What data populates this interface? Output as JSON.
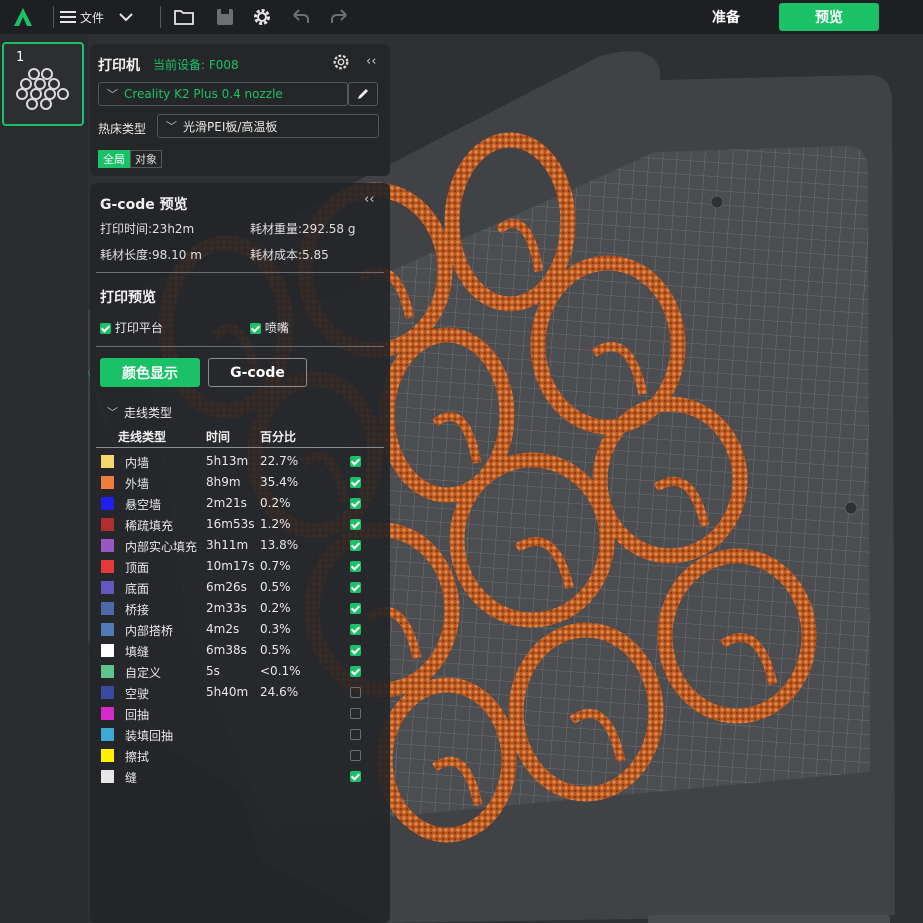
{
  "topbar": {
    "file_label": "文件",
    "prepare_label": "准备",
    "preview_label": "预览"
  },
  "plates": [
    {
      "number": "1"
    }
  ],
  "printer": {
    "title": "打印机",
    "current_device": "当前设备: F008",
    "printer_name": "Creality K2 Plus 0.4 nozzle",
    "bed_label": "热床类型",
    "bed_value": "光滑PEI板/高温板",
    "tab_global": "全局",
    "tab_object": "对象"
  },
  "gcode": {
    "title": "G-code 预览",
    "print_time": "打印时间:23h2m",
    "filament_weight": "耗材重量:292.58 g",
    "filament_length": "耗材长度:98.10 m",
    "filament_cost": "耗材成本:5.85",
    "preview_title": "打印预览",
    "show_plate_label": "打印平台",
    "show_nozzle_label": "喷嘴",
    "color_mode_label": "颜色显示",
    "gcode_mode_label": "G-code",
    "view_type": "走线类型",
    "columns": [
      "走线类型",
      "时间",
      "百分比"
    ],
    "legend": [
      {
        "name": "内墙",
        "time": "5h13m",
        "pct": "22.7%",
        "color": "#f5d76e",
        "checked": true
      },
      {
        "name": "外墙",
        "time": "8h9m",
        "pct": "35.4%",
        "color": "#f07e3c",
        "checked": true
      },
      {
        "name": "悬空墙",
        "time": "2m21s",
        "pct": "0.2%",
        "color": "#1f1ff0",
        "checked": true
      },
      {
        "name": "稀疏填充",
        "time": "16m53s",
        "pct": "1.2%",
        "color": "#b22e2e",
        "checked": true
      },
      {
        "name": "内部实心填充",
        "time": "3h11m",
        "pct": "13.8%",
        "color": "#9957c4",
        "checked": true
      },
      {
        "name": "顶面",
        "time": "10m17s",
        "pct": "0.7%",
        "color": "#e53a3a",
        "checked": true
      },
      {
        "name": "底面",
        "time": "6m26s",
        "pct": "0.5%",
        "color": "#6656c0",
        "checked": true
      },
      {
        "name": "桥接",
        "time": "2m33s",
        "pct": "0.2%",
        "color": "#4d6aa8",
        "checked": true
      },
      {
        "name": "内部搭桥",
        "time": "4m2s",
        "pct": "0.3%",
        "color": "#4f7ab5",
        "checked": true
      },
      {
        "name": "填缝",
        "time": "6m38s",
        "pct": "0.5%",
        "color": "#ffffff",
        "checked": true
      },
      {
        "name": "自定义",
        "time": "5s",
        "pct": "<0.1%",
        "color": "#5ec48f",
        "checked": true
      },
      {
        "name": "空驶",
        "time": "5h40m",
        "pct": "24.6%",
        "color": "#3a4aa0",
        "checked": false
      },
      {
        "name": "回抽",
        "time": "",
        "pct": "",
        "color": "#d22bc9",
        "checked": false
      },
      {
        "name": "装填回抽",
        "time": "",
        "pct": "",
        "color": "#3fa9d6",
        "checked": false
      },
      {
        "name": "擦拭",
        "time": "",
        "pct": "",
        "color": "#ffef00",
        "checked": false
      },
      {
        "name": "缝",
        "time": "",
        "pct": "",
        "color": "#e6e6e6",
        "checked": true
      }
    ]
  },
  "colors": {
    "accent": "#1bc167",
    "model": "#c8632a"
  },
  "icons": [
    "app-logo-icon",
    "menu-icon",
    "chevron-down-icon",
    "open-folder-icon",
    "save-icon",
    "settings-icon",
    "undo-icon",
    "redo-icon",
    "gear-icon",
    "collapse-icon",
    "edit-icon"
  ]
}
